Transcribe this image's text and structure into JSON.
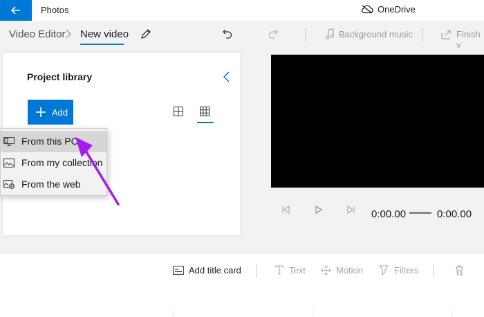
{
  "titlebar": {
    "app_title": "Photos",
    "onedrive_label": "OneDrive"
  },
  "cmdbar": {
    "breadcrumb_root": "Video Editor",
    "breadcrumb_current": "New video",
    "background_music": "Background music",
    "finish_video": "Finish v"
  },
  "library": {
    "title": "Project library",
    "add_label": "Add"
  },
  "menu": {
    "items": [
      {
        "label": "From this PC",
        "icon": "pc-icon"
      },
      {
        "label": "From my collection",
        "icon": "collection-icon"
      },
      {
        "label": "From the web",
        "icon": "web-icon"
      }
    ]
  },
  "playback": {
    "current_time": "0:00.00",
    "total_time": "0:00.00"
  },
  "storyboard": {
    "add_title_card": "Add title card",
    "text": "Text",
    "motion": "Motion",
    "filters": "Filters"
  },
  "colors": {
    "accent": "#0078d7",
    "annotation_arrow": "#a61cf0"
  }
}
